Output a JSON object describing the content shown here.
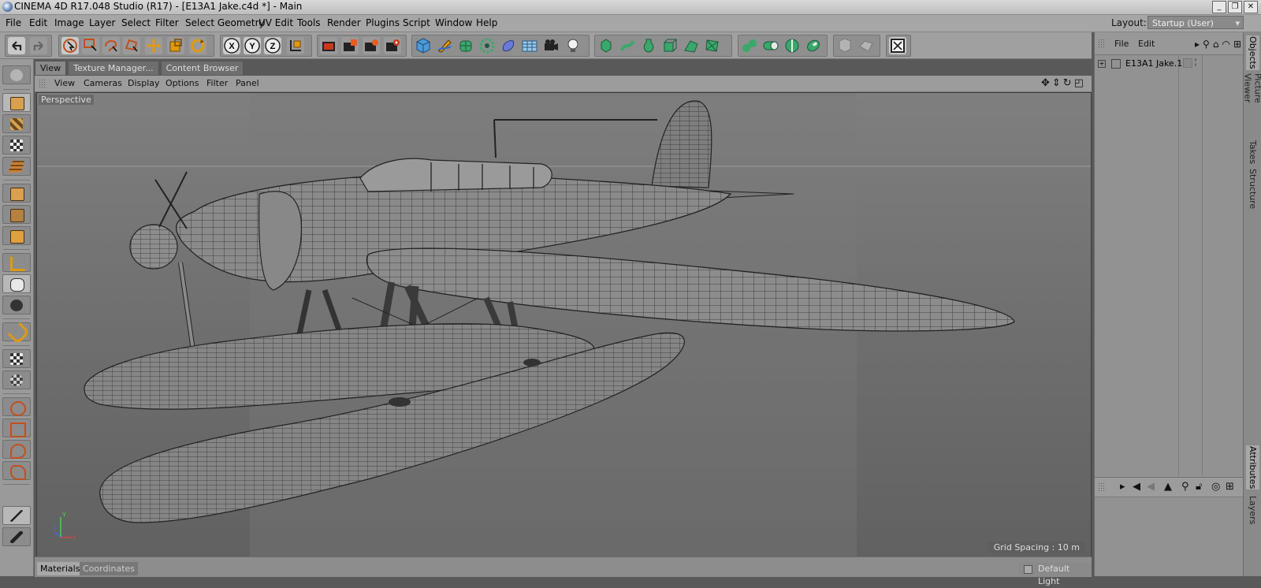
{
  "window": {
    "title": "CINEMA 4D R17.048 Studio (R17) - [E13A1 Jake.c4d *] - Main",
    "buttons": [
      "_",
      "❐",
      "✕"
    ]
  },
  "menubar": {
    "items": [
      "File",
      "Edit",
      "Image",
      "Layer",
      "Select",
      "Filter",
      "Select Geometry",
      "UV Edit",
      "Tools",
      "Render",
      "Plugins",
      "Script",
      "Window",
      "Help"
    ],
    "layout_label": "Layout:",
    "layout_value": "Startup (User)"
  },
  "viewport": {
    "tabs": [
      "View",
      "Texture Manager...",
      "Content Browser"
    ],
    "menu": [
      "View",
      "Cameras",
      "Display",
      "Options",
      "Filter",
      "Panel"
    ],
    "camera_label": "Perspective",
    "grid_spacing": "Grid Spacing : 10 m",
    "axes": {
      "x": "x",
      "y": "Y",
      "z": "z"
    }
  },
  "bottom": {
    "tabs": [
      "Materials",
      "Coordinates"
    ],
    "default_light": "Default Light"
  },
  "object_manager": {
    "menu": [
      "File",
      "Edit"
    ],
    "objects": [
      {
        "name": "E13A1 Jake.1"
      }
    ]
  },
  "side_tabs": [
    "Objects",
    "Picture Viewer",
    "Takes",
    "Structure",
    "Attributes",
    "Layers"
  ],
  "toolbar": {
    "icons": [
      "undo-icon",
      "redo-icon",
      "live-selection-icon",
      "rectangle-selection-icon",
      "lasso-selection-icon",
      "polygon-selection-icon",
      "move-icon",
      "scale-icon",
      "rotate-icon",
      "x-axis-icon",
      "y-axis-icon",
      "z-axis-icon",
      "coordinate-system-icon",
      "render-view-icon",
      "render-picture-viewer-icon",
      "edit-render-settings-icon",
      "render-queue-icon",
      "cube-icon",
      "pen-icon",
      "subdivision-surface-icon",
      "array-icon",
      "deformer-icon",
      "floor-icon",
      "camera-icon",
      "light-icon",
      "spline-icon",
      "sweep-icon",
      "lathe-icon",
      "extrude-icon",
      "loft-icon",
      "polygon-pen-icon",
      "metaball-icon",
      "boole-icon",
      "symmetry-icon",
      "instance-icon",
      "sds-weight-icon",
      "fullscreen-icon"
    ]
  },
  "left_tools": [
    "make-editable-icon",
    "model-mode-icon",
    "texture-mode-icon",
    "workplane-icon",
    "axis-mode-icon",
    "points-mode-icon",
    "edges-mode-icon",
    "polygons-mode-icon",
    "enable-axis-icon",
    "tweak-mode-icon",
    "snapping-icon",
    "magnet-icon",
    "locked-workplane-icon",
    "planar-workplane-icon",
    "live-selection-icon",
    "rectangle-selection-icon",
    "lasso-selection-icon",
    "polygon-selection-icon",
    "brush-icon",
    "eyedropper-icon"
  ]
}
